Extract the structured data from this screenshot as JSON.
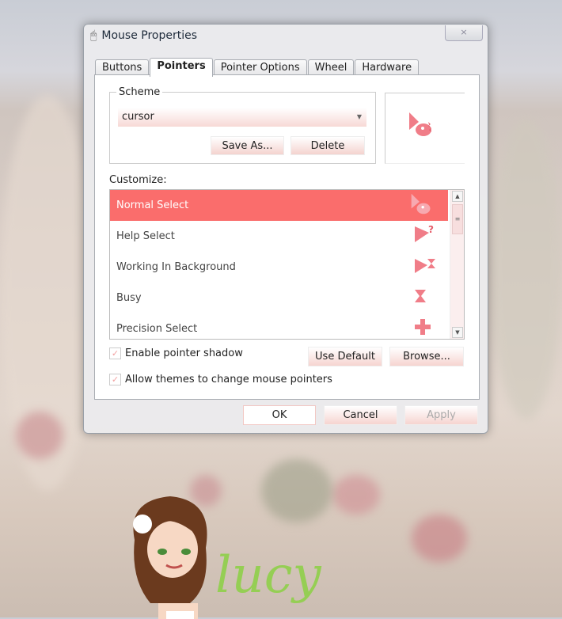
{
  "window": {
    "title": "Mouse Properties",
    "close_icon": "×"
  },
  "tabs": [
    "Buttons",
    "Pointers",
    "Pointer Options",
    "Wheel",
    "Hardware"
  ],
  "active_tab": "Pointers",
  "scheme": {
    "legend": "Scheme",
    "value": "cursor",
    "save_as": "Save As...",
    "delete": "Delete"
  },
  "customize": {
    "label": "Customize:",
    "items": [
      {
        "label": "Normal Select",
        "selected": true,
        "icon": "dino-arrow-icon"
      },
      {
        "label": "Help Select",
        "icon": "help-arrow-icon"
      },
      {
        "label": "Working In Background",
        "icon": "working-arrow-icon"
      },
      {
        "label": "Busy",
        "icon": "hourglass-icon"
      },
      {
        "label": "Precision Select",
        "icon": "crosshair-icon"
      }
    ]
  },
  "shadow": {
    "label": "Enable pointer shadow",
    "checked": true
  },
  "themes": {
    "label": "Allow themes to change mouse pointers",
    "checked": true
  },
  "use_default": "Use Default",
  "browse": "Browse...",
  "footer": {
    "ok": "OK",
    "cancel": "Cancel",
    "apply": "Apply"
  },
  "watermark": "lucy",
  "colors": {
    "accent": "#fa6d6c",
    "cursor": "#f07d88"
  }
}
